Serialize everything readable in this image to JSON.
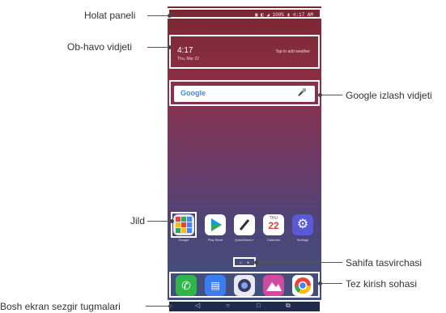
{
  "callouts": {
    "status_bar": "Holat paneli",
    "weather_widget": "Ob-havo vidjeti",
    "google_widget": "Google izlash vidjeti",
    "folder": "Jild",
    "page_indicator": "Sahifa tasvirchasi",
    "quick_access": "Tez kirish sohasi",
    "nav_buttons": "Bosh ekran sezgir tugmalari"
  },
  "phone": {
    "status_text": "▣ ◧ ◢ 100% ▮ 4:17 AM",
    "weather": {
      "time": "4:17",
      "ampm": "AM",
      "date": "Thu, Mar 22",
      "tap": "Tap to add weather"
    },
    "search": {
      "logo": "Google",
      "mic": "mic-icon"
    },
    "apps": [
      {
        "label": "Google",
        "icon": "folder-icon"
      },
      {
        "label": "Play Store",
        "icon": "play-store-icon"
      },
      {
        "label": "QuickMemo+",
        "icon": "quickmemo-icon"
      },
      {
        "label": "Calendar",
        "icon": "calendar-icon",
        "day": "THU",
        "date": "22"
      },
      {
        "label": "Settings",
        "icon": "settings-icon"
      }
    ],
    "dock": [
      "phone-icon",
      "messages-icon",
      "camera-icon",
      "gallery-icon",
      "chrome-icon"
    ],
    "nav": {
      "back": "◁",
      "home": "○",
      "recents": "□",
      "dual": "⧉"
    }
  }
}
